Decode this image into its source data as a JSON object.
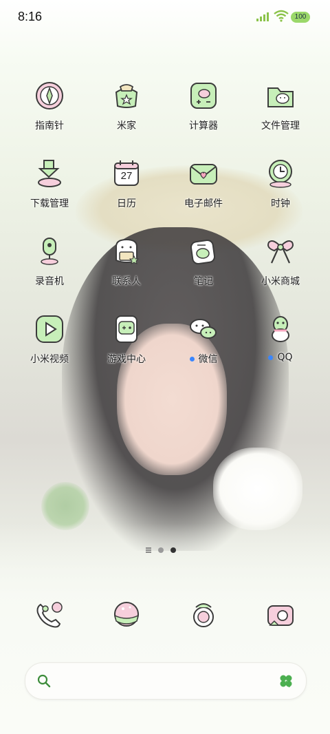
{
  "status_bar": {
    "time": "8:16",
    "battery": "100"
  },
  "apps": [
    {
      "label": "指南针",
      "icon": "compass-icon"
    },
    {
      "label": "米家",
      "icon": "mi-home-icon"
    },
    {
      "label": "计算器",
      "icon": "calculator-icon"
    },
    {
      "label": "文件管理",
      "icon": "file-manager-icon"
    },
    {
      "label": "下载管理",
      "icon": "download-manager-icon"
    },
    {
      "label": "日历",
      "icon": "calendar-icon",
      "calendar_day": "27"
    },
    {
      "label": "电子邮件",
      "icon": "email-icon"
    },
    {
      "label": "时钟",
      "icon": "clock-icon"
    },
    {
      "label": "录音机",
      "icon": "recorder-icon"
    },
    {
      "label": "联系人",
      "icon": "contacts-icon"
    },
    {
      "label": "笔记",
      "icon": "notes-icon"
    },
    {
      "label": "小米商城",
      "icon": "mi-store-icon"
    },
    {
      "label": "小米视频",
      "icon": "mi-video-icon"
    },
    {
      "label": "游戏中心",
      "icon": "game-center-icon"
    },
    {
      "label": "微信",
      "icon": "wechat-icon",
      "new_badge": true
    },
    {
      "label": "QQ",
      "icon": "qq-icon",
      "new_badge": true
    }
  ],
  "dock": [
    {
      "icon": "phone-icon"
    },
    {
      "icon": "messages-icon"
    },
    {
      "icon": "browser-icon"
    },
    {
      "icon": "camera-icon"
    }
  ],
  "pager": {
    "pages": 2,
    "active_page": 2
  },
  "colors": {
    "icon_green": "#c7efb9",
    "icon_pink": "#f8c6d7",
    "outline": "#3b3b3b",
    "badge_blue": "#3a86ff"
  }
}
